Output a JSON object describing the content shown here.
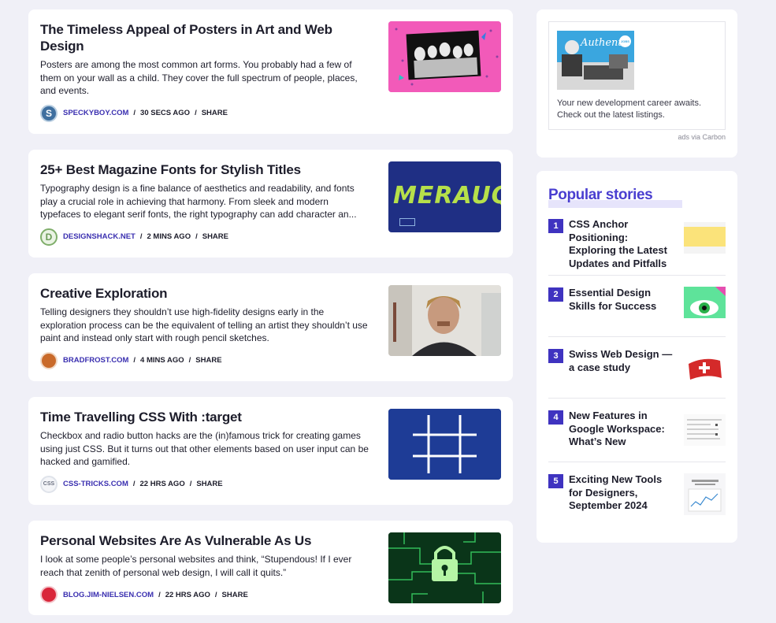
{
  "articles": [
    {
      "title": "The Timeless Appeal of Posters in Art and Web Design",
      "excerpt": "Posters are among the most common art forms. You probably had a few of them on your wall as a child. They cover the full spectrum of people, places, and events.",
      "source": "SPECKYBOY.COM",
      "time": "30 SECS AGO",
      "share": "SHARE",
      "favicon_letter": "S",
      "favicon_color": "#3f6f9f"
    },
    {
      "title": "25+ Best Magazine Fonts for Stylish Titles",
      "excerpt": "Typography design is a fine balance of aesthetics and readability, and fonts play a crucial role in achieving that harmony. From sleek and modern typefaces to elegant serif fonts, the right typography can add character an...",
      "source": "DESIGNSHACK.NET",
      "time": "2 MINS AGO",
      "share": "SHARE",
      "favicon_letter": "d",
      "favicon_color": "#7fae6a",
      "thumb_text": "MERAUQ"
    },
    {
      "title": "Creative Exploration",
      "excerpt": "Telling designers they shouldn’t use high-fidelity designs early in the exploration process can be the equivalent of telling an artist they shouldn’t use paint and instead only start with rough pencil sketches.",
      "source": "BRADFROST.COM",
      "time": "4 MINS AGO",
      "share": "SHARE",
      "favicon_letter": "",
      "favicon_color": "#c96a2a"
    },
    {
      "title": "Time Travelling CSS With :target",
      "excerpt": "Checkbox and radio button hacks are the (in)famous trick for creating games using just CSS. But it turns out that other elements based on user input can be hacked and gamified.",
      "source": "CSS-TRICKS.COM",
      "time": "22 HRS AGO",
      "share": "SHARE",
      "favicon_letter": "css",
      "favicon_color": "#dfe3ea"
    },
    {
      "title": "Personal Websites Are As Vulnerable As Us",
      "excerpt": "I look at some people’s personal websites and think, “Stupendous! If I ever reach that zenith of personal web design, I will call it quits.”",
      "source": "BLOG.JIM-NIELSEN.COM",
      "time": "22 HRS AGO",
      "share": "SHARE",
      "favicon_letter": "",
      "favicon_color": "#d9263a"
    }
  ],
  "ad": {
    "image_text": "Authentic",
    "image_badge": "JOBS",
    "text": "Your new development career awaits. Check out the latest listings.",
    "via": "ads via Carbon"
  },
  "popular": {
    "heading": "Popular stories",
    "items": [
      {
        "num": "1",
        "title": "CSS Anchor Positioning: Exploring the Latest Updates and Pitfalls"
      },
      {
        "num": "2",
        "title": "Essential Design Skills for Success"
      },
      {
        "num": "3",
        "title": "Swiss Web Design — a case study"
      },
      {
        "num": "4",
        "title": "New Features in Google Workspace: What’s New"
      },
      {
        "num": "5",
        "title": "Exciting New Tools for Designers, September 2024"
      }
    ]
  }
}
